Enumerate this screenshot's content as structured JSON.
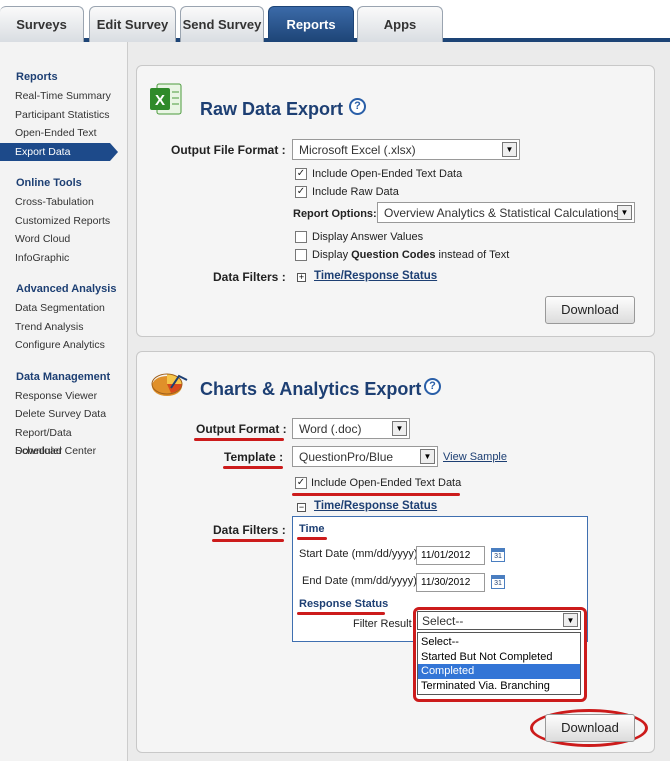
{
  "tabs": [
    {
      "label": "Surveys"
    },
    {
      "label": "Edit Survey"
    },
    {
      "label": "Send Survey"
    },
    {
      "label": "Reports"
    },
    {
      "label": "Apps"
    }
  ],
  "sidebar": {
    "reports": {
      "heading": "Reports",
      "items": [
        "Real-Time Summary",
        "Participant Statistics",
        "Open-Ended Text",
        "Export Data"
      ]
    },
    "online_tools": {
      "heading": "Online Tools",
      "items": [
        "Cross-Tabulation",
        "Customized Reports",
        "Word Cloud",
        "InfoGraphic"
      ]
    },
    "advanced": {
      "heading": "Advanced Analysis",
      "items": [
        "Data Segmentation",
        "Trend Analysis",
        "Configure Analytics"
      ]
    },
    "data_mgmt": {
      "heading": "Data Management",
      "items": [
        "Response Viewer",
        "Delete Survey Data",
        "Report/Data Scheduler",
        "Download Center"
      ]
    }
  },
  "raw": {
    "title": "Raw Data Export",
    "help": "?",
    "format_label": "Output File Format :",
    "format_value": "Microsoft Excel (.xlsx)",
    "include_open_ended": "Include Open-Ended Text Data",
    "include_raw": "Include Raw Data",
    "report_options_label": "Report Options:",
    "report_options_value": "Overview Analytics & Statistical Calculations",
    "display_answer_values": "Display Answer Values",
    "display_prefix": "Display ",
    "display_question_codes": "Question Codes",
    "display_suffix": " instead of Text",
    "filters_label": "Data Filters :",
    "filter_link": "Time/Response Status",
    "plus": "+",
    "download": "Download"
  },
  "charts": {
    "title": "Charts & Analytics Export",
    "help": "?",
    "format_label": "Output Format :",
    "format_value": "Word (.doc)",
    "template_label": "Template :",
    "template_value": "QuestionPro/Blue",
    "view_sample": "View Sample",
    "include_open_ended": "Include Open-Ended Text Data",
    "minus": "−",
    "filter_link": "Time/Response Status",
    "filters_label": "Data Filters :",
    "time_heading": "Time",
    "start_label": "Start Date (mm/dd/yyyy)",
    "start_value": "11/01/2012",
    "end_label": "End Date (mm/dd/yyyy)",
    "end_value": "11/30/2012",
    "cal_icon": "31",
    "status_heading": "Response Status",
    "filter_result_label": "Filter Result",
    "filter_selected": "Select--",
    "options": [
      "Select--",
      "Started But Not Completed",
      "Completed",
      "Terminated Via. Branching"
    ],
    "highlighted_option": "Completed",
    "download": "Download"
  },
  "colors": {
    "accent": "#1d4476",
    "annotation": "#cc1b1b",
    "highlight": "#3375d6"
  }
}
